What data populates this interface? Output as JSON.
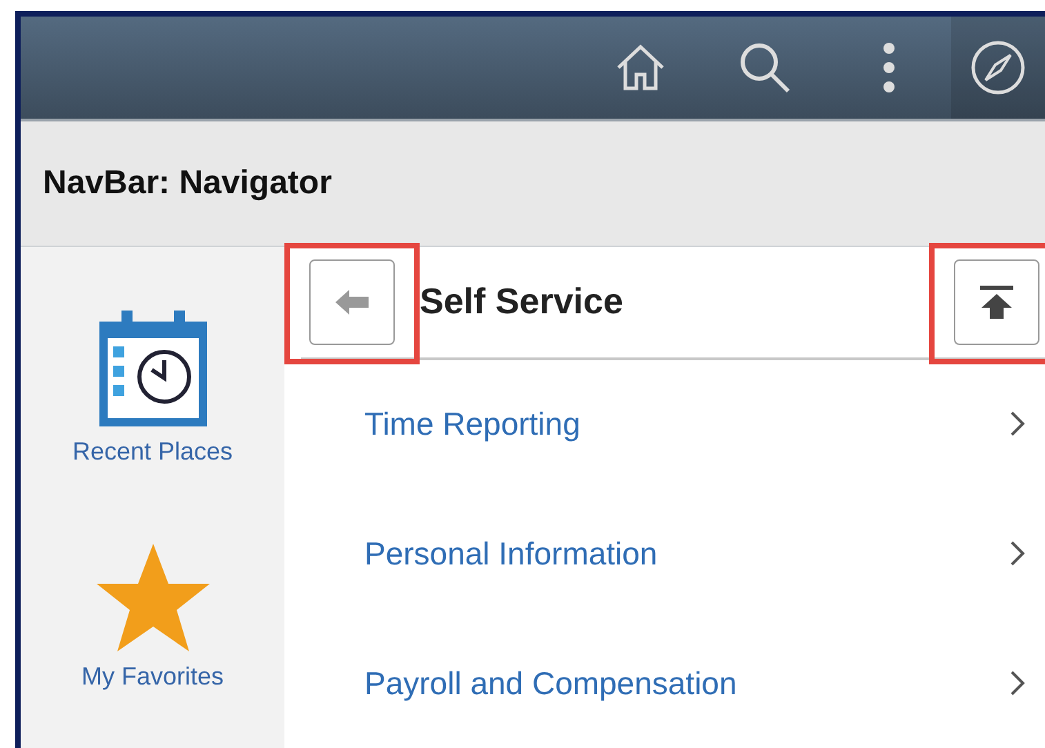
{
  "header": {
    "title": "NavBar: Navigator"
  },
  "sidebar": {
    "items": [
      {
        "kind": "recent",
        "label": "Recent Places"
      },
      {
        "kind": "favorites",
        "label": "My Favorites"
      }
    ]
  },
  "panel": {
    "title": "Self Service",
    "back_button": {
      "highlighted": true
    },
    "top_button": {
      "highlighted": true
    },
    "items": [
      {
        "label": "Time Reporting"
      },
      {
        "label": "Personal Information"
      },
      {
        "label": "Payroll and Compensation"
      }
    ]
  }
}
